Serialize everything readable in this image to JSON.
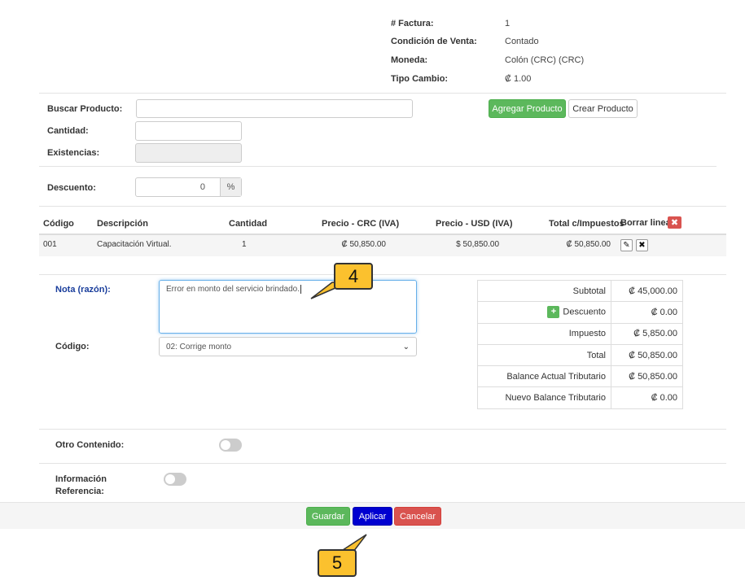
{
  "header": {
    "factura_label": "# Factura:",
    "factura_value": "1",
    "condicion_label": "Condición de Venta:",
    "condicion_value": "Contado",
    "moneda_label": "Moneda:",
    "moneda_value": "Colón (CRC) (CRC)",
    "tipo_cambio_label": "Tipo Cambio:",
    "tipo_cambio_value": "₡ 1.00"
  },
  "product_form": {
    "buscar_label": "Buscar Producto:",
    "buscar_value": "",
    "cantidad_label": "Cantidad:",
    "cantidad_value": "",
    "existencias_label": "Existencias:",
    "existencias_value": "",
    "descuento_label": "Descuento:",
    "descuento_value": "0",
    "descuento_suffix": "%",
    "agregar_button": "Agregar Producto",
    "crear_button": "Crear Producto"
  },
  "table": {
    "headers": {
      "codigo": "Código",
      "descripcion": "Descripción",
      "cantidad": "Cantidad",
      "precio_crc": "Precio - CRC (IVA)",
      "precio_usd": "Precio - USD (IVA)",
      "total": "Total c/Impuestos",
      "borrar": "Borrar lineas"
    },
    "rows": [
      {
        "codigo": "001",
        "descripcion": "Capacitación Virtual.",
        "cantidad": "1",
        "precio_crc": "₡ 50,850.00",
        "precio_usd": "$ 50,850.00",
        "total": "₡ 50,850.00"
      }
    ]
  },
  "nota": {
    "label": "Nota (razón):",
    "value": "Error en monto del servicio brindado.",
    "codigo_label": "Código:",
    "codigo_selected": "02: Corrige monto"
  },
  "totals": {
    "subtotal_label": "Subtotal",
    "subtotal_value": "₡ 45,000.00",
    "descuento_label": "Descuento",
    "descuento_value": "₡ 0.00",
    "impuesto_label": "Impuesto",
    "impuesto_value": "₡ 5,850.00",
    "total_label": "Total",
    "total_value": "₡ 50,850.00",
    "balance_actual_label": "Balance Actual Tributario",
    "balance_actual_value": "₡ 50,850.00",
    "nuevo_balance_label": "Nuevo Balance Tributario",
    "nuevo_balance_value": "₡ 0.00"
  },
  "extras": {
    "otro_contenido_label": "Otro Contenido:",
    "info_referencia_label_1": "Información",
    "info_referencia_label_2": "Referencia:"
  },
  "footer": {
    "guardar": "Guardar",
    "aplicar": "Aplicar",
    "cancelar": "Cancelar"
  },
  "callouts": {
    "step4": "4",
    "step5": "5"
  },
  "icons": {
    "borrar_icon": "close-icon",
    "edit_icon": "pencil-icon",
    "delete_icon": "close-icon",
    "descuento_add_icon": "plus-icon",
    "select_arrow": "chevron-down-icon"
  },
  "colors": {
    "green": "#5cb85c",
    "blue": "#0000d0",
    "red": "#d9534f",
    "nota_label": "#1a3e9c",
    "callout": "#fbc12e"
  }
}
